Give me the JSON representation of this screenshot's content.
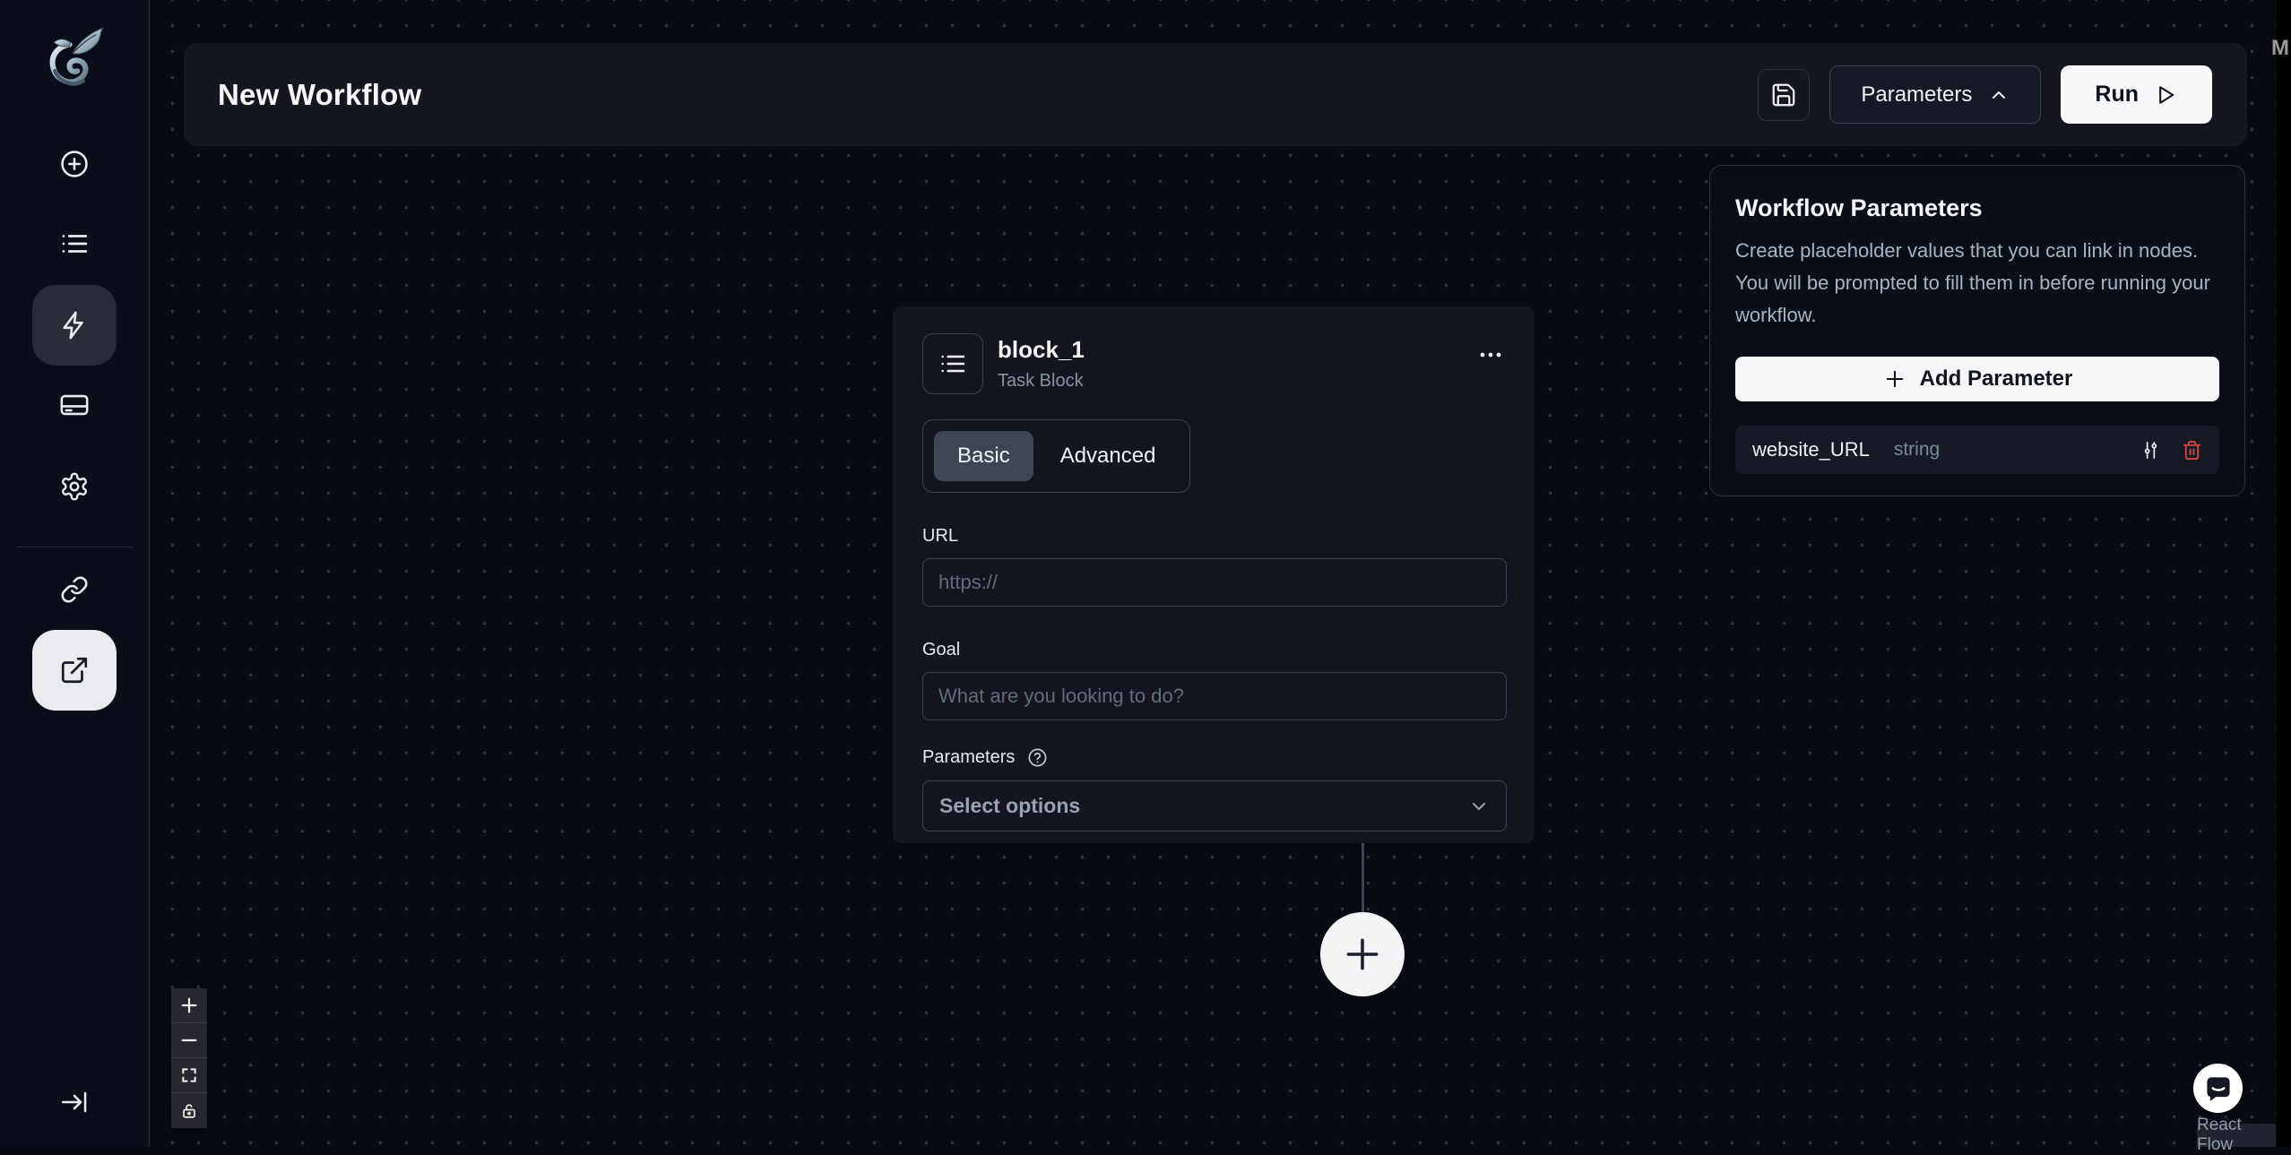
{
  "header": {
    "title": "New Workflow",
    "save_icon": "save-icon",
    "parameters_button": "Parameters",
    "run_button": "Run"
  },
  "sidebar": {
    "logo": "skyvern-dragon-logo",
    "items": [
      {
        "id": "create",
        "icon": "plus-circle-icon",
        "active": false
      },
      {
        "id": "runs-history",
        "icon": "list-icon",
        "active": false
      },
      {
        "id": "workflows",
        "icon": "lightning-icon",
        "active": true
      },
      {
        "id": "billing",
        "icon": "credit-card-icon",
        "active": false
      },
      {
        "id": "settings",
        "icon": "gear-icon",
        "active": false
      },
      {
        "id": "integrations",
        "icon": "link-icon",
        "active": false
      },
      {
        "id": "open-external",
        "icon": "external-link-icon",
        "active": true
      }
    ],
    "collapse_icon": "arrow-to-bar-icon"
  },
  "block": {
    "name": "block_1",
    "type_label": "Task Block",
    "menu_icon": "ellipsis-icon",
    "tabs": [
      {
        "label": "Basic",
        "active": true
      },
      {
        "label": "Advanced",
        "active": false
      }
    ],
    "url": {
      "label": "URL",
      "placeholder": "https://",
      "value": ""
    },
    "goal": {
      "label": "Goal",
      "placeholder": "What are you looking to do?",
      "value": ""
    },
    "parameters": {
      "label": "Parameters",
      "help_icon": "help-circle-icon",
      "value": "Select options",
      "chevron": "chevron-down-icon"
    }
  },
  "parameters_panel": {
    "title": "Workflow Parameters",
    "description": "Create placeholder values that you can link in nodes. You will be prompted to fill them in before running your workflow.",
    "add_button_label": "Add Parameter",
    "rows": [
      {
        "key": "website_URL",
        "type": "string",
        "actions": [
          "sliders-icon",
          "trash-icon"
        ]
      }
    ]
  },
  "flow_controls": [
    {
      "id": "zoom-in",
      "icon": "plus-icon"
    },
    {
      "id": "zoom-out",
      "icon": "minus-icon"
    },
    {
      "id": "fit-view",
      "icon": "fit-view-icon"
    },
    {
      "id": "lock",
      "icon": "lock-icon"
    }
  ],
  "attribution": "React Flow",
  "misc": {
    "edge_text_fragment": "M"
  },
  "colors": {
    "canvas_bg": "#060a13",
    "panel_bg": "#14161f",
    "accent_light": "#f7f8f9",
    "danger": "#d9453f",
    "muted_text": "#8b93a3"
  }
}
